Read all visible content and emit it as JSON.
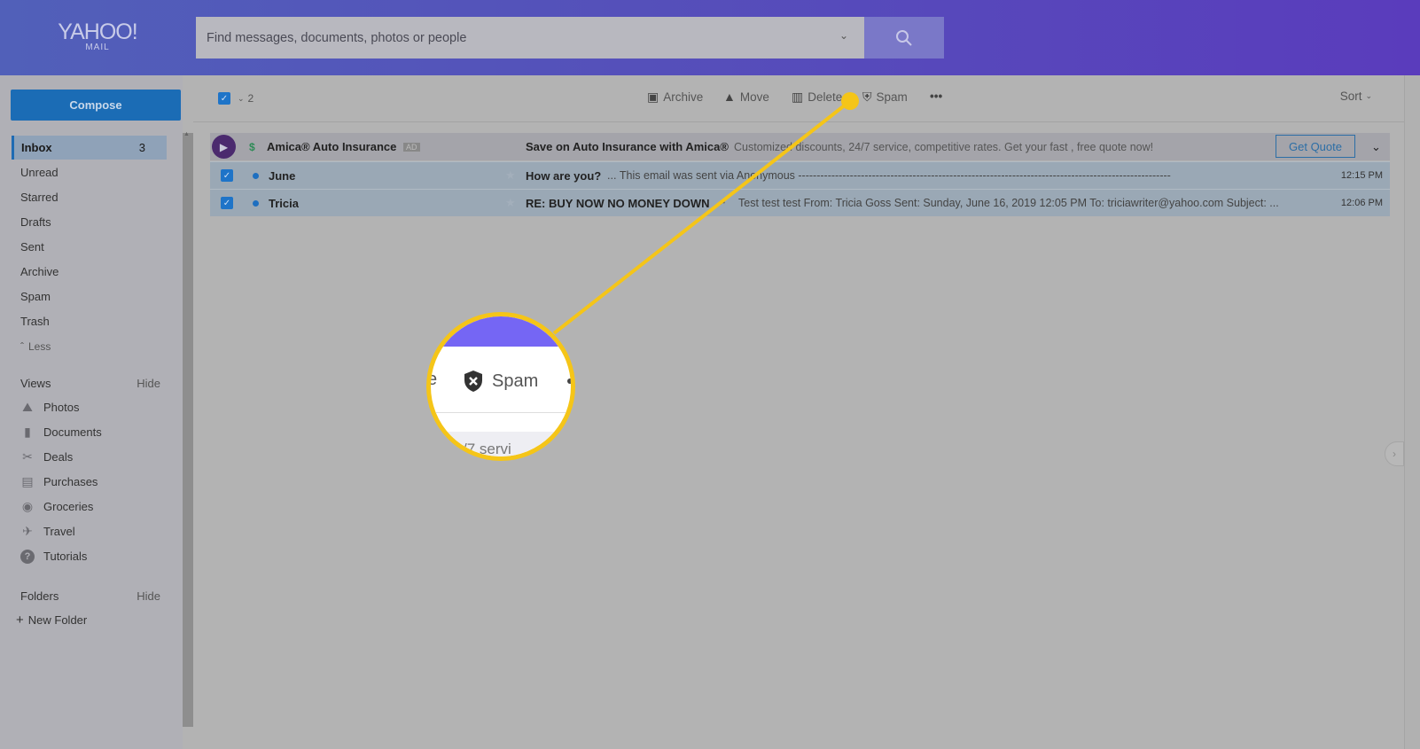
{
  "header": {
    "logo_text": "YAHOO!",
    "logo_sub": "MAIL",
    "search_placeholder": "Find messages, documents, photos or people"
  },
  "sidebar": {
    "compose": "Compose",
    "folders": [
      {
        "label": "Inbox",
        "count": "3"
      },
      {
        "label": "Unread"
      },
      {
        "label": "Starred"
      },
      {
        "label": "Drafts"
      },
      {
        "label": "Sent"
      },
      {
        "label": "Archive"
      },
      {
        "label": "Spam"
      },
      {
        "label": "Trash"
      }
    ],
    "less": "Less",
    "views_title": "Views",
    "views_hide": "Hide",
    "views": [
      {
        "label": "Photos",
        "icon": "photo-icon"
      },
      {
        "label": "Documents",
        "icon": "document-icon"
      },
      {
        "label": "Deals",
        "icon": "scissors-icon"
      },
      {
        "label": "Purchases",
        "icon": "receipt-icon"
      },
      {
        "label": "Groceries",
        "icon": "basket-icon"
      },
      {
        "label": "Travel",
        "icon": "plane-icon"
      },
      {
        "label": "Tutorials",
        "icon": "help-icon"
      }
    ],
    "folders_title": "Folders",
    "folders_hide": "Hide",
    "new_folder": "New Folder"
  },
  "toolbar": {
    "selected_count": "2",
    "archive": "Archive",
    "move": "Move",
    "delete": "Delete",
    "spam": "Spam",
    "more": "•••",
    "sort": "Sort"
  },
  "ad": {
    "sender": "Amica® Auto Insurance",
    "badge": "AD",
    "subject": "Save on Auto Insurance with Amica®",
    "snippet": "Customized discounts, 24/7 service, competitive rates. Get your fast , free quote now!",
    "cta": "Get Quote"
  },
  "messages": [
    {
      "sender": "June",
      "subject": "How are you?",
      "snippet": "----------------------------------------------------------------------------------------------------- This email was sent via Anonymous ...",
      "time": "12:15 PM",
      "selected": true
    },
    {
      "sender": "Tricia",
      "subject": "RE: BUY NOW NO MONEY DOWN",
      "snippet": "Test test test From: Tricia Goss Sent: Sunday, June 16, 2019 12:05 PM To: triciawriter@yahoo.com Subject: ...",
      "time": "12:06 PM",
      "selected": true
    }
  ],
  "callout": {
    "label": "Spam",
    "partial_left": "e",
    "partial_bottom": "/7 servi",
    "highlight_color": "#f5c518"
  }
}
